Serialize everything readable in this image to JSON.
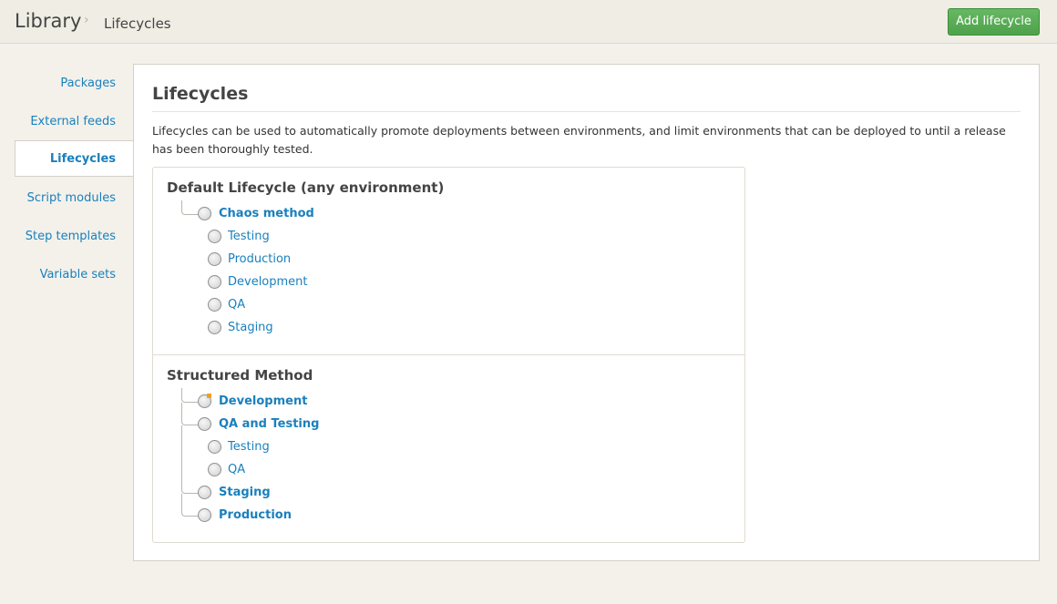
{
  "header": {
    "breadcrumb_root": "Library",
    "breadcrumb_separator": "›",
    "breadcrumb_current": "Lifecycles",
    "add_button_label": "Add lifecycle"
  },
  "sidebar": {
    "items": [
      {
        "label": "Packages"
      },
      {
        "label": "External feeds"
      },
      {
        "label": "Lifecycles",
        "active": true
      },
      {
        "label": "Script modules"
      },
      {
        "label": "Step templates"
      },
      {
        "label": "Variable sets"
      }
    ]
  },
  "main": {
    "title": "Lifecycles",
    "description": "Lifecycles can be used to automatically promote deployments between environments, and limit environments that can be deployed to until a release has been thoroughly tested.",
    "lifecycles": [
      {
        "name": "Default Lifecycle (any environment)",
        "phases": [
          {
            "label": "Chaos method",
            "environments": [
              "Testing",
              "Production",
              "Development",
              "QA",
              "Staging"
            ]
          }
        ]
      },
      {
        "name": "Structured Method",
        "phases": [
          {
            "label": "Development",
            "environments": []
          },
          {
            "label": "QA and Testing",
            "environments": [
              "Testing",
              "QA"
            ]
          },
          {
            "label": "Staging",
            "environments": []
          },
          {
            "label": "Production",
            "environments": []
          }
        ]
      }
    ]
  },
  "colors": {
    "link": "#1a80bd",
    "add_button": "#55a852",
    "phase_marker": "#f0a020"
  }
}
